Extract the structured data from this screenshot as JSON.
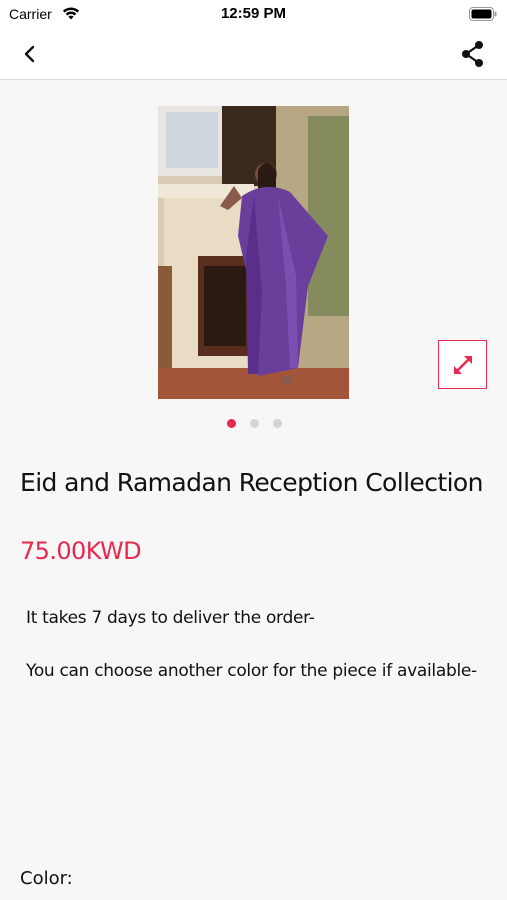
{
  "status_bar": {
    "carrier": "Carrier",
    "time": "12:59 PM"
  },
  "product": {
    "title": "Eid and Ramadan Reception Collection",
    "price": "75.00KWD",
    "description": [
      "It takes 7 days to deliver the order-",
      "You can choose another color for the piece if available-"
    ],
    "color_label": "Color:",
    "image_count": 3,
    "active_image_index": 0
  },
  "colors": {
    "accent": "#e8294f",
    "dress": "#6a3f9c"
  }
}
